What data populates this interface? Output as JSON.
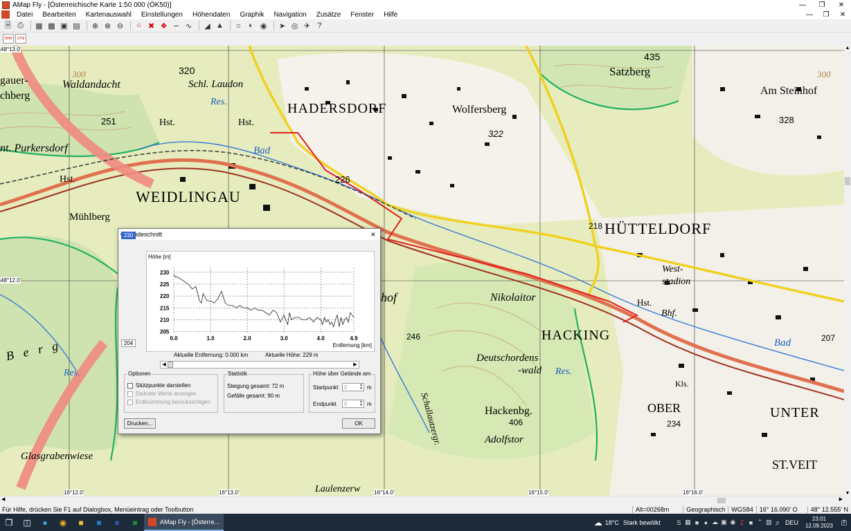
{
  "window": {
    "title": "AMap Fly - [Österreichische Karte 1:50 000 (ÖK50)]"
  },
  "menu": [
    "Datei",
    "Bearbeiten",
    "Kartenauswahl",
    "Einstellungen",
    "Höhendaten",
    "Graphik",
    "Navigation",
    "Zusätze",
    "Fenster",
    "Hilfe"
  ],
  "toolbar2": {
    "ohn": "ÖHN",
    "utm": "UTM"
  },
  "map": {
    "coords_left": [
      "48°13.0'",
      "48°12.0'"
    ],
    "coords_bottom": [
      "16°12.0'",
      "16°13.0'",
      "16°14.0'",
      "16°15.0'",
      "16°16.0'"
    ],
    "places": [
      {
        "text": "gauer-",
        "cls": "place"
      },
      {
        "text": "chberg",
        "cls": "place"
      },
      {
        "text": "Waldandacht",
        "cls": "place"
      },
      {
        "text": "nt. Purkersdorf",
        "cls": "place"
      },
      {
        "text": "WEIDLINGAU",
        "cls": "town"
      },
      {
        "text": "Mühlberg",
        "cls": "place"
      },
      {
        "text": "HADERSDORF",
        "cls": "town"
      },
      {
        "text": "Schl. Laudon",
        "cls": "place"
      },
      {
        "text": "Wolfersberg",
        "cls": "place"
      },
      {
        "text": "HÜTTELDORF",
        "cls": "town"
      },
      {
        "text": "Satzberg",
        "cls": "place"
      },
      {
        "text": "Am Steinhof",
        "cls": "place"
      },
      {
        "text": "Nikolaitor",
        "cls": "place"
      },
      {
        "text": "HACKING",
        "cls": "town"
      },
      {
        "text": "Deutschordens",
        "cls": "place"
      },
      {
        "text": "-wald",
        "cls": "place"
      },
      {
        "text": "Hackenbg.",
        "cls": "place"
      },
      {
        "text": "Adolfstor",
        "cls": "place"
      },
      {
        "text": "OBER",
        "cls": "town"
      },
      {
        "text": "UNTER",
        "cls": "town"
      },
      {
        "text": "ST.VEIT",
        "cls": "town"
      },
      {
        "text": "Glasgrabenwiese",
        "cls": "place"
      },
      {
        "text": "Laulenzerw",
        "cls": "place"
      },
      {
        "text": "Schallautzergr.",
        "cls": "place"
      },
      {
        "text": "West-",
        "cls": "place"
      },
      {
        "text": "stadion",
        "cls": "place"
      },
      {
        "text": "Bhf.",
        "cls": "place"
      },
      {
        "text": "Res.",
        "cls": "water"
      },
      {
        "text": "Bad",
        "cls": "water"
      },
      {
        "text": "Res.",
        "cls": "water"
      },
      {
        "text": "Bad",
        "cls": "water"
      },
      {
        "text": "Res.",
        "cls": "water"
      },
      {
        "text": "Hst.",
        "cls": "place"
      },
      {
        "text": "Hst.",
        "cls": "place"
      },
      {
        "text": "Hst.",
        "cls": "place"
      },
      {
        "text": "Hst.",
        "cls": "place"
      },
      {
        "text": "hof",
        "cls": "place"
      },
      {
        "text": "Berg",
        "cls": "place"
      },
      {
        "text": "Kls.",
        "cls": "place"
      }
    ],
    "heights": [
      "320",
      "251",
      "226",
      "322",
      "435",
      "328",
      "300",
      "300",
      "246",
      "406",
      "234",
      "207",
      "218"
    ]
  },
  "dialog": {
    "title": "Geländeschnitt",
    "close": "×",
    "y_top_value": "230",
    "y_bottom_value": "204",
    "readout_distance": "Aktuelle Entfernung: 0.000 km",
    "readout_height": "Aktuelle Höhe: 229 m",
    "options_title": "Optionen",
    "options": [
      {
        "label": "Stützpunkte darstellen",
        "enabled": true
      },
      {
        "label": "Diskrete Werte anzeigen",
        "enabled": false
      },
      {
        "label": "Erdkrümmung berücksichtigen",
        "enabled": false
      }
    ],
    "stats_title": "Statistik",
    "stats": [
      "Steigung gesamt: 72 m",
      "Gefälle gesamt: 90 m"
    ],
    "height_title": "Höhe über Gelände am",
    "startpunkt": "Startpunkt",
    "endpunkt": "Endpunkt",
    "start_value": "0",
    "end_value": "0",
    "unit_m": "m",
    "print_button": "Drucken...",
    "ok_button": "OK"
  },
  "chart_data": {
    "type": "line",
    "ylabel": "Höhe [m]",
    "xlabel": "Entfernung [km]",
    "xlim": [
      0,
      4.9
    ],
    "ylim": [
      204,
      232
    ],
    "x_ticks": [
      "0.0",
      "1.0",
      "2.0",
      "3.0",
      "4.0",
      "4.9"
    ],
    "y_ticks": [
      "205",
      "210",
      "215",
      "220",
      "225",
      "230"
    ],
    "grid": true,
    "series": [
      {
        "x": [
          0.0,
          0.05,
          0.1,
          0.2,
          0.3,
          0.4,
          0.5,
          0.6,
          0.7,
          0.75,
          0.8,
          0.9,
          1.0,
          1.1,
          1.2,
          1.3,
          1.4,
          1.5,
          1.6,
          1.7,
          1.8,
          1.9,
          2.0,
          2.1,
          2.2,
          2.3,
          2.4,
          2.5,
          2.6,
          2.7,
          2.8,
          2.9,
          3.0,
          3.05,
          3.1,
          3.15,
          3.2,
          3.3,
          3.4,
          3.5,
          3.6,
          3.7,
          3.8,
          3.9,
          4.0,
          4.05,
          4.1,
          4.15,
          4.2,
          4.25,
          4.3,
          4.35,
          4.4,
          4.45,
          4.5,
          4.55,
          4.6,
          4.65,
          4.7,
          4.75,
          4.8,
          4.85,
          4.9
        ],
        "y": [
          229,
          228,
          228,
          227,
          226,
          225,
          223,
          224,
          218,
          217,
          221,
          218,
          218,
          217,
          219,
          222,
          217,
          216,
          216,
          215,
          216,
          215,
          215,
          214,
          215,
          214,
          214,
          213,
          212,
          214,
          213,
          209,
          212,
          210,
          208,
          213,
          210,
          211,
          211,
          210,
          210,
          211,
          209,
          211,
          210,
          208,
          211,
          209,
          210,
          208,
          209,
          207,
          210,
          212,
          207,
          211,
          208,
          210,
          211,
          209,
          213,
          212,
          211
        ]
      }
    ]
  },
  "statusbar": {
    "hint": "Für Hilfe, drücken Sie F1 auf Dialogbox, Menüeintrag oder Toolbutton",
    "alt": "Alt=00268m",
    "proj": "Geographisch",
    "datum": "WGS84",
    "lon": "16° 16.090' O",
    "lat": "48° 12.555' N"
  },
  "taskbar": {
    "app_label": "AMap Fly - [Österre...",
    "weather_temp": "18°C",
    "weather_text": "Stark bewölkt",
    "lang": "DEU",
    "time": "23:01",
    "date": "12.09.2023",
    "notif": "2"
  }
}
